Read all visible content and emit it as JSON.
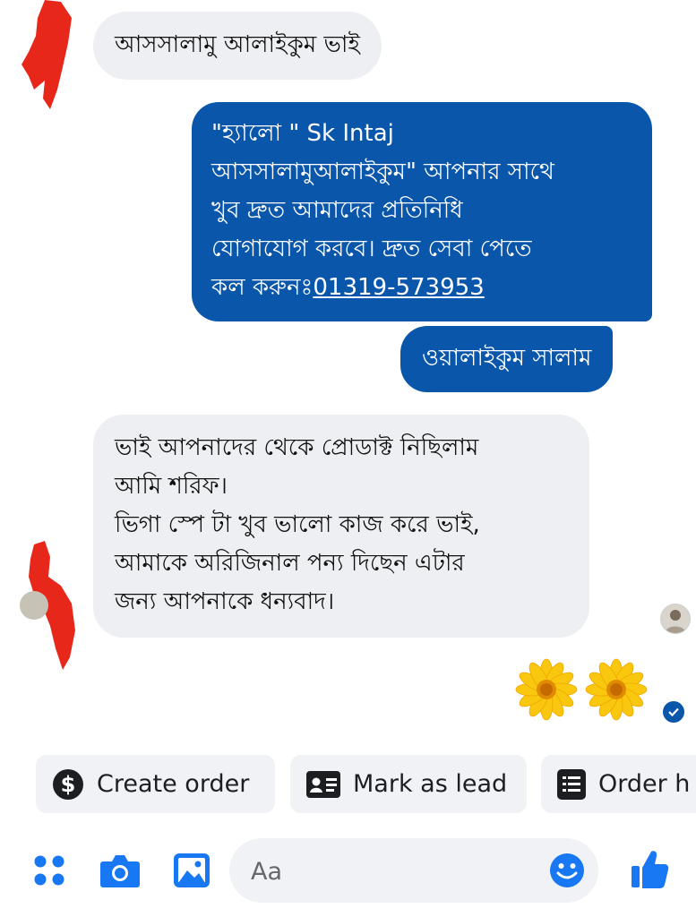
{
  "messages": {
    "m1": {
      "text": "আসসালামু আলাইকুম ভাই"
    },
    "m2": {
      "lines": [
        "\"হ্যালো \" Sk Intaj",
        "আসসালামুআলাইকুম\" আপনার সাথে",
        "খুব দ্রুত আমাদের প্রতিনিধি",
        "যোগাযোগ করবে। দ্রুত সেবা পেতে"
      ],
      "last_line_prefix": "কল করুনঃ",
      "phone": "01319-573953"
    },
    "m3": {
      "text": "ওয়ালাইকুম সালাম"
    },
    "m4": {
      "lines": [
        "ভাই আপনাদের থেকে প্রোডাক্ট নিছিলাম",
        "আমি শরিফ।",
        "ভিগা স্পে টা খুব ভালো কাজ করে ভাই,",
        "আমাকে অরিজিনাল পন্য দিছেন এটার",
        "জন্য আপনাকে ধন্যবাদ।"
      ]
    }
  },
  "quick_actions": [
    {
      "label": "Create order",
      "icon": "dollar-icon"
    },
    {
      "label": "Mark as lead",
      "icon": "contact-card-icon"
    },
    {
      "label": "Order h",
      "icon": "receipt-icon"
    }
  ],
  "composer": {
    "placeholder": "Aa",
    "icons": [
      "apps-icon",
      "camera-icon",
      "gallery-icon",
      "emoji-icon",
      "thumbs-up-icon"
    ]
  },
  "colors": {
    "accent": "#0a56ab",
    "incoming_bubble": "#eeeff2",
    "redaction": "#e8271b",
    "icon_blue": "#1877f2"
  }
}
